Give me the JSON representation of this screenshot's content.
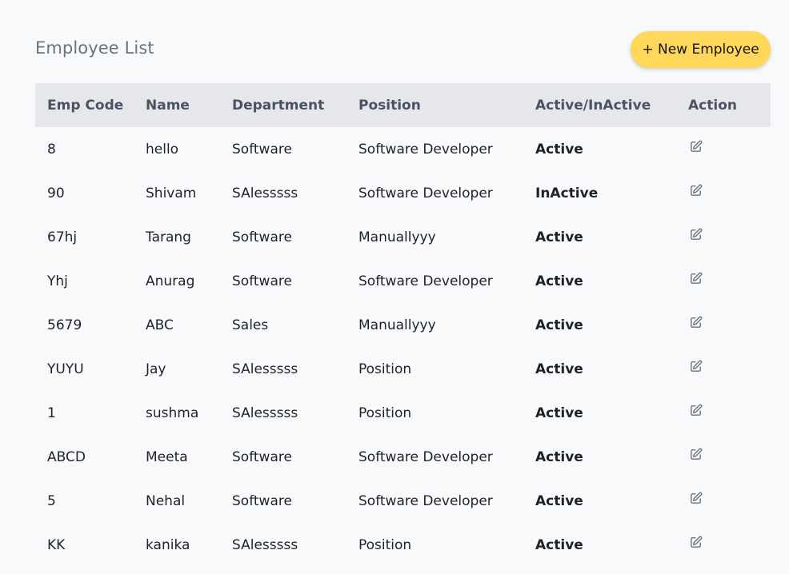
{
  "page": {
    "title": "Employee List",
    "new_button": {
      "label": "+ New Employee"
    }
  },
  "table": {
    "columns": [
      "Emp Code",
      "Name",
      "Department",
      "Position",
      "Active/InActive",
      "Action"
    ],
    "rows": [
      {
        "emp_code": "8",
        "name": "hello",
        "department": "Software",
        "position": "Software Developer",
        "status": "Active"
      },
      {
        "emp_code": "90",
        "name": "Shivam",
        "department": "SAlesssss",
        "position": "Software Developer",
        "status": "InActive"
      },
      {
        "emp_code": "67hj",
        "name": "Tarang",
        "department": "Software",
        "position": "Manuallyyy",
        "status": "Active"
      },
      {
        "emp_code": "Yhj",
        "name": "Anurag",
        "department": "Software",
        "position": "Software Developer",
        "status": "Active"
      },
      {
        "emp_code": "5679",
        "name": "ABC",
        "department": "Sales",
        "position": "Manuallyyy",
        "status": "Active"
      },
      {
        "emp_code": "YUYU",
        "name": "Jay",
        "department": "SAlesssss",
        "position": "Position",
        "status": "Active"
      },
      {
        "emp_code": "1",
        "name": "sushma",
        "department": "SAlesssss",
        "position": "Position",
        "status": "Active"
      },
      {
        "emp_code": "ABCD",
        "name": "Meeta",
        "department": "Software",
        "position": "Software Developer",
        "status": "Active"
      },
      {
        "emp_code": "5",
        "name": "Nehal",
        "department": "Software",
        "position": "Software Developer",
        "status": "Active"
      },
      {
        "emp_code": "KK",
        "name": "kanika",
        "department": "SAlesssss",
        "position": "Position",
        "status": "Active"
      }
    ]
  },
  "colors": {
    "background": "#f8f9fb",
    "title": "#6a7280",
    "header_bg": "#e6e7ea",
    "header_text": "#4a5362",
    "active": "#16a34a",
    "inactive": "#dc2626",
    "new_button_bg": "#ffd85a"
  },
  "icons": {
    "edit": "edit-icon"
  }
}
